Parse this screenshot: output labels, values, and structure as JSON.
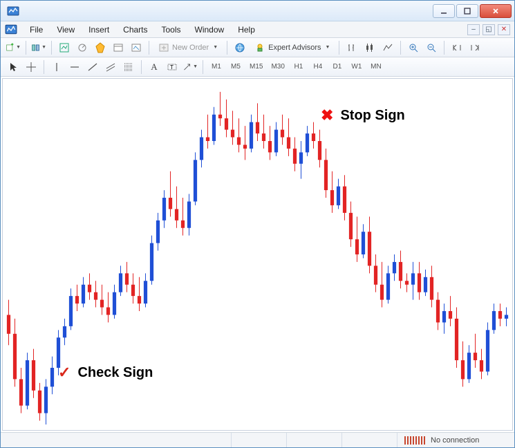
{
  "menu": {
    "file": "File",
    "view": "View",
    "insert": "Insert",
    "charts": "Charts",
    "tools": "Tools",
    "window": "Window",
    "help": "Help"
  },
  "toolbar": {
    "new_order": "New Order",
    "expert_advisors": "Expert Advisors"
  },
  "timeframes": {
    "m1": "M1",
    "m5": "M5",
    "m15": "M15",
    "m30": "M30",
    "h1": "H1",
    "h4": "H4",
    "d1": "D1",
    "w1": "W1",
    "mn": "MN"
  },
  "annotations": {
    "stop": "Stop Sign",
    "check": "Check Sign"
  },
  "status": {
    "connection": "No connection"
  },
  "chart_data": {
    "type": "candlestick",
    "timeframe": "H1",
    "candles": [
      {
        "o": 58,
        "h": 66,
        "l": 42,
        "c": 48
      },
      {
        "o": 48,
        "h": 56,
        "l": 20,
        "c": 24
      },
      {
        "o": 24,
        "h": 30,
        "l": 6,
        "c": 10
      },
      {
        "o": 10,
        "h": 38,
        "l": 8,
        "c": 34
      },
      {
        "o": 34,
        "h": 40,
        "l": 14,
        "c": 18
      },
      {
        "o": 18,
        "h": 22,
        "l": 2,
        "c": 6
      },
      {
        "o": 6,
        "h": 24,
        "l": 0,
        "c": 20
      },
      {
        "o": 20,
        "h": 36,
        "l": 16,
        "c": 30
      },
      {
        "o": 30,
        "h": 50,
        "l": 26,
        "c": 46
      },
      {
        "o": 46,
        "h": 56,
        "l": 42,
        "c": 52
      },
      {
        "o": 52,
        "h": 72,
        "l": 50,
        "c": 68
      },
      {
        "o": 68,
        "h": 74,
        "l": 60,
        "c": 64
      },
      {
        "o": 64,
        "h": 78,
        "l": 62,
        "c": 74
      },
      {
        "o": 74,
        "h": 80,
        "l": 66,
        "c": 70
      },
      {
        "o": 70,
        "h": 76,
        "l": 62,
        "c": 66
      },
      {
        "o": 66,
        "h": 74,
        "l": 58,
        "c": 62
      },
      {
        "o": 62,
        "h": 70,
        "l": 54,
        "c": 58
      },
      {
        "o": 58,
        "h": 74,
        "l": 56,
        "c": 70
      },
      {
        "o": 70,
        "h": 84,
        "l": 68,
        "c": 80
      },
      {
        "o": 80,
        "h": 86,
        "l": 70,
        "c": 74
      },
      {
        "o": 74,
        "h": 80,
        "l": 64,
        "c": 68
      },
      {
        "o": 68,
        "h": 78,
        "l": 60,
        "c": 64
      },
      {
        "o": 64,
        "h": 80,
        "l": 62,
        "c": 76
      },
      {
        "o": 76,
        "h": 100,
        "l": 74,
        "c": 96
      },
      {
        "o": 96,
        "h": 112,
        "l": 92,
        "c": 108
      },
      {
        "o": 108,
        "h": 124,
        "l": 104,
        "c": 120
      },
      {
        "o": 120,
        "h": 134,
        "l": 110,
        "c": 114
      },
      {
        "o": 114,
        "h": 126,
        "l": 104,
        "c": 108
      },
      {
        "o": 108,
        "h": 120,
        "l": 100,
        "c": 104
      },
      {
        "o": 104,
        "h": 122,
        "l": 100,
        "c": 118
      },
      {
        "o": 118,
        "h": 144,
        "l": 116,
        "c": 140
      },
      {
        "o": 140,
        "h": 156,
        "l": 136,
        "c": 152
      },
      {
        "o": 152,
        "h": 164,
        "l": 146,
        "c": 150
      },
      {
        "o": 150,
        "h": 168,
        "l": 148,
        "c": 164
      },
      {
        "o": 164,
        "h": 176,
        "l": 158,
        "c": 162
      },
      {
        "o": 162,
        "h": 172,
        "l": 152,
        "c": 156
      },
      {
        "o": 156,
        "h": 166,
        "l": 148,
        "c": 152
      },
      {
        "o": 152,
        "h": 162,
        "l": 144,
        "c": 148
      },
      {
        "o": 148,
        "h": 158,
        "l": 140,
        "c": 146
      },
      {
        "o": 146,
        "h": 164,
        "l": 144,
        "c": 160
      },
      {
        "o": 160,
        "h": 170,
        "l": 150,
        "c": 154
      },
      {
        "o": 154,
        "h": 164,
        "l": 146,
        "c": 150
      },
      {
        "o": 150,
        "h": 158,
        "l": 140,
        "c": 144
      },
      {
        "o": 144,
        "h": 160,
        "l": 142,
        "c": 156
      },
      {
        "o": 156,
        "h": 164,
        "l": 148,
        "c": 152
      },
      {
        "o": 152,
        "h": 162,
        "l": 142,
        "c": 146
      },
      {
        "o": 146,
        "h": 152,
        "l": 134,
        "c": 138
      },
      {
        "o": 138,
        "h": 150,
        "l": 130,
        "c": 144
      },
      {
        "o": 144,
        "h": 158,
        "l": 142,
        "c": 154
      },
      {
        "o": 154,
        "h": 160,
        "l": 146,
        "c": 150
      },
      {
        "o": 150,
        "h": 156,
        "l": 136,
        "c": 140
      },
      {
        "o": 140,
        "h": 146,
        "l": 120,
        "c": 124
      },
      {
        "o": 124,
        "h": 134,
        "l": 112,
        "c": 116
      },
      {
        "o": 116,
        "h": 130,
        "l": 114,
        "c": 126
      },
      {
        "o": 126,
        "h": 132,
        "l": 108,
        "c": 112
      },
      {
        "o": 112,
        "h": 118,
        "l": 94,
        "c": 98
      },
      {
        "o": 98,
        "h": 110,
        "l": 86,
        "c": 90
      },
      {
        "o": 90,
        "h": 106,
        "l": 88,
        "c": 102
      },
      {
        "o": 102,
        "h": 110,
        "l": 80,
        "c": 84
      },
      {
        "o": 84,
        "h": 90,
        "l": 70,
        "c": 74
      },
      {
        "o": 74,
        "h": 86,
        "l": 62,
        "c": 66
      },
      {
        "o": 66,
        "h": 84,
        "l": 64,
        "c": 80
      },
      {
        "o": 80,
        "h": 90,
        "l": 76,
        "c": 86
      },
      {
        "o": 86,
        "h": 92,
        "l": 72,
        "c": 76
      },
      {
        "o": 76,
        "h": 80,
        "l": 70,
        "c": 74
      },
      {
        "o": 74,
        "h": 86,
        "l": 66,
        "c": 80
      },
      {
        "o": 80,
        "h": 86,
        "l": 66,
        "c": 70
      },
      {
        "o": 70,
        "h": 82,
        "l": 68,
        "c": 78
      },
      {
        "o": 78,
        "h": 84,
        "l": 62,
        "c": 66
      },
      {
        "o": 66,
        "h": 70,
        "l": 50,
        "c": 54
      },
      {
        "o": 54,
        "h": 64,
        "l": 48,
        "c": 60
      },
      {
        "o": 60,
        "h": 68,
        "l": 52,
        "c": 56
      },
      {
        "o": 56,
        "h": 62,
        "l": 30,
        "c": 34
      },
      {
        "o": 34,
        "h": 44,
        "l": 20,
        "c": 24
      },
      {
        "o": 24,
        "h": 42,
        "l": 22,
        "c": 38
      },
      {
        "o": 38,
        "h": 48,
        "l": 30,
        "c": 34
      },
      {
        "o": 34,
        "h": 40,
        "l": 24,
        "c": 28
      },
      {
        "o": 28,
        "h": 54,
        "l": 26,
        "c": 50
      },
      {
        "o": 50,
        "h": 64,
        "l": 48,
        "c": 60
      },
      {
        "o": 60,
        "h": 64,
        "l": 52,
        "c": 56
      },
      {
        "o": 56,
        "h": 62,
        "l": 52,
        "c": 58
      }
    ],
    "y_range": [
      0,
      180
    ],
    "colors": {
      "bull": "#1f4fd6",
      "bear": "#e22424",
      "wick": "#000000"
    }
  }
}
